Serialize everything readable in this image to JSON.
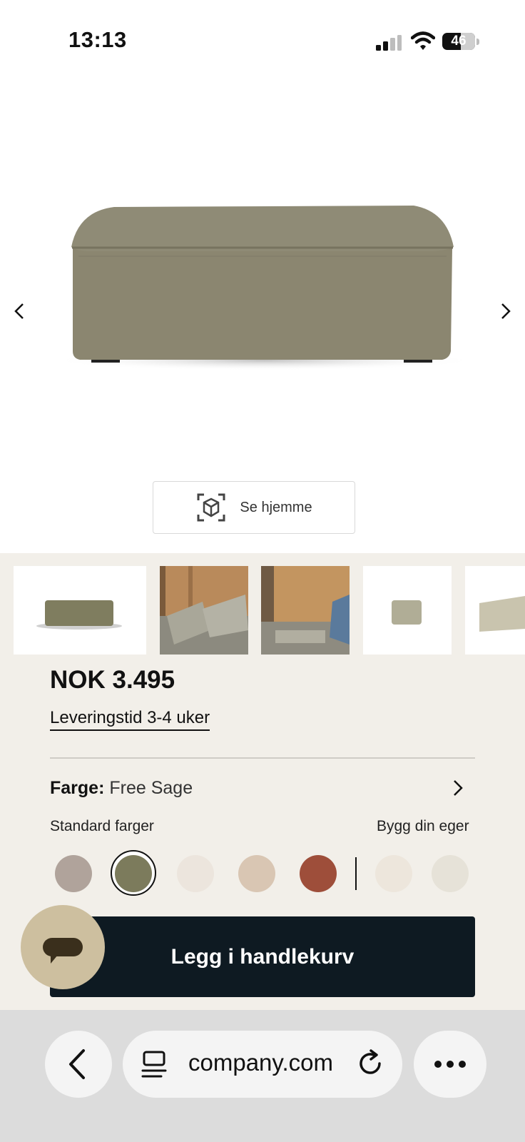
{
  "status_bar": {
    "time": "13:13",
    "battery": "46"
  },
  "hero": {
    "ar_button_label": "Se hjemme"
  },
  "product": {
    "price": "NOK 3.495",
    "delivery": "Leveringstid 3-4 uker",
    "color_key": "Farge:",
    "color_value": "Free Sage",
    "standard_colors_label": "Standard farger",
    "build_own_label": "Bygg din eger",
    "swatches": [
      "#b0a39b",
      "#7c7b5c",
      "#ece5dd",
      "#d9c6b3",
      "#9e4e3a",
      "#ede6dc",
      "#e6e2d8"
    ],
    "cart_button": "Legg i handlekurv"
  },
  "browser": {
    "url": "company.com"
  },
  "colors": {
    "accent_dark": "#0e1a22",
    "chat": "#cdbf9f",
    "panel_bg": "#f2efe9"
  }
}
